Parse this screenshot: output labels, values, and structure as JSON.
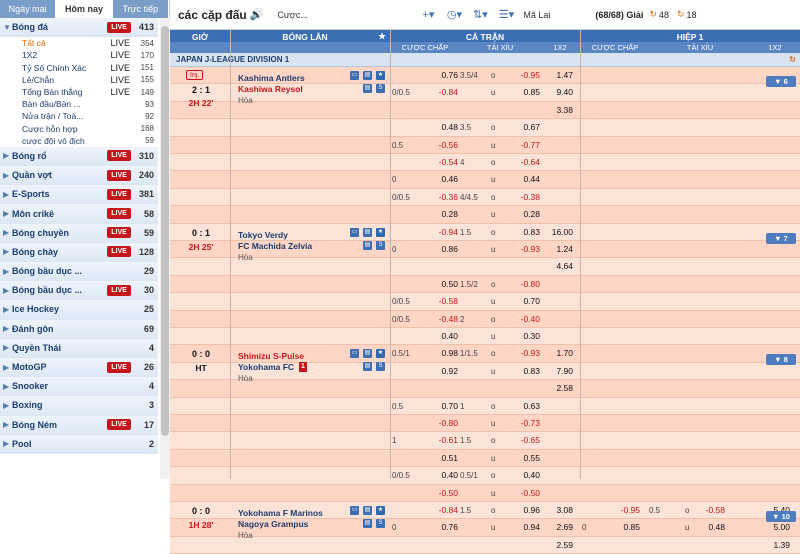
{
  "left_tabs": [
    "Ngày mai",
    "Hôm nay",
    "Trực tiếp"
  ],
  "active_tab": 1,
  "sports": [
    {
      "name": "Bóng đá",
      "live": true,
      "count": "413",
      "expanded": true,
      "subs": [
        {
          "name": "Tất cả",
          "live": true,
          "count": "354",
          "active": true
        },
        {
          "name": "1X2",
          "live": true,
          "count": "170"
        },
        {
          "name": "Tỷ Số Chính Xác",
          "live": true,
          "count": "151"
        },
        {
          "name": "Lẻ/Chẵn",
          "live": true,
          "count": "155"
        },
        {
          "name": "Tổng Bàn thắng",
          "live": true,
          "count": "149"
        },
        {
          "name": "Bàn đầu/Bàn ...",
          "live": false,
          "count": "93"
        },
        {
          "name": "Nửa trận / Toà...",
          "live": false,
          "count": "92"
        },
        {
          "name": "Cược hỗn hợp",
          "live": false,
          "count": "168"
        },
        {
          "name": "cược đội vô địch",
          "live": false,
          "count": "59"
        }
      ]
    },
    {
      "name": "Bóng rổ",
      "live": true,
      "count": "310"
    },
    {
      "name": "Quần vợt",
      "live": true,
      "count": "240"
    },
    {
      "name": "E-Sports",
      "live": true,
      "count": "381"
    },
    {
      "name": "Môn crikê",
      "live": true,
      "count": "58"
    },
    {
      "name": "Bóng chuyền",
      "live": true,
      "count": "59"
    },
    {
      "name": "Bóng chày",
      "live": true,
      "count": "128"
    },
    {
      "name": "Bóng bầu dục ...",
      "live": false,
      "count": "29"
    },
    {
      "name": "Bóng bầu dục ...",
      "live": true,
      "count": "30"
    },
    {
      "name": "Ice Hockey",
      "live": false,
      "count": "25"
    },
    {
      "name": "Đánh gôn",
      "live": false,
      "count": "69"
    },
    {
      "name": "Quyền Thái",
      "live": false,
      "count": "4"
    },
    {
      "name": "MotoGP",
      "live": true,
      "count": "26"
    },
    {
      "name": "Snooker",
      "live": false,
      "count": "4"
    },
    {
      "name": "Boxing",
      "live": false,
      "count": "3"
    },
    {
      "name": "Bóng Ném",
      "live": true,
      "count": "17"
    },
    {
      "name": "Pool",
      "live": false,
      "count": "2"
    }
  ],
  "live_label": "LIVE",
  "topbar": {
    "title": "các cặp đấu",
    "search": "Cược...",
    "odds_type": "Mã Lai",
    "count": "(68/68) Giải",
    "refresh1": "48",
    "refresh2": "18"
  },
  "header": {
    "time": "GIỜ",
    "match": "BÓNG LĂN",
    "ft": "CẢ TRẬN",
    "h1": "HIỆP 1",
    "hdp": "CƯỢC CHẤP",
    "ou": "TÀI XỈU",
    "x12": "1X2"
  },
  "league": "JAPAN J-LEAGUE DIVISION 1",
  "matches": [
    {
      "inj": "Inj.",
      "score": "2 : 1",
      "time": "2H 22'",
      "home": "Kashima Antlers",
      "away": "Kashiwa Reysol",
      "draw": "Hòa",
      "more": "▼ 6",
      "home_red": false,
      "away_red": true,
      "home_card": false
    },
    {
      "score": "0 : 1",
      "time": "2H 25'",
      "home": "Tokyo Verdy",
      "away": "FC Machida Zelvia",
      "draw": "Hòa",
      "more": "▼ 7",
      "home_red": false,
      "away_red": false
    },
    {
      "score": "0 : 0",
      "time": "HT",
      "home": "Shimizu S-Pulse",
      "away": "Yokohama FC",
      "draw": "Hòa",
      "more": "▼ 8",
      "home_red": true,
      "away_red": false,
      "away_card": "1"
    },
    {
      "score": "0 : 0",
      "time": "1H 28'",
      "home": "Yokohama F Marinos",
      "away": "Nagoya Grampus",
      "draw": "Hòa",
      "more": "▼ 10",
      "home_red": false,
      "away_red": false
    }
  ],
  "odds_rows": [
    [
      "",
      "0.76",
      "3.5/4",
      "o",
      "-0.95",
      "1.47"
    ],
    [
      "0/0.5",
      "-0.84",
      "",
      "u",
      "0.85",
      "9.40"
    ],
    [
      "",
      "",
      "",
      "",
      "",
      "3.38"
    ],
    [
      "",
      "0.48",
      "3.5",
      "o",
      "0.67",
      ""
    ],
    [
      "0.5",
      "-0.56",
      "",
      "u",
      "-0.77",
      ""
    ],
    [
      "",
      "-0.54",
      "4",
      "o",
      "-0.64",
      ""
    ],
    [
      "0",
      "0.46",
      "",
      "u",
      "0.44",
      ""
    ],
    [
      "0/0.5",
      "-0.36",
      "4/4.5",
      "o",
      "-0.38",
      ""
    ],
    [
      "",
      "0.28",
      "",
      "u",
      "0.28",
      ""
    ],
    [
      "",
      "-0.94",
      "1.5",
      "o",
      "0.83",
      "16.00"
    ],
    [
      "0",
      "0.86",
      "",
      "u",
      "-0.93",
      "1.24"
    ],
    [
      "",
      "",
      "",
      "",
      "",
      "4.64"
    ],
    [
      "",
      "0.50",
      "1.5/2",
      "o",
      "-0.80",
      ""
    ],
    [
      "0/0.5",
      "-0.58",
      "",
      "u",
      "0.70",
      ""
    ],
    [
      "0/0.5",
      "-0.48",
      "2",
      "o",
      "-0.40",
      ""
    ],
    [
      "",
      "0.40",
      "",
      "u",
      "0.30",
      ""
    ],
    [
      "0.5/1",
      "0.98",
      "1/1.5",
      "o",
      "-0.93",
      "1.70"
    ],
    [
      "",
      "0.92",
      "",
      "u",
      "0.83",
      "7.90"
    ],
    [
      "",
      "",
      "",
      "",
      "",
      "2.58"
    ],
    [
      "0.5",
      "0.70",
      "1",
      "o",
      "0.63",
      ""
    ],
    [
      "",
      "-0.80",
      "",
      "u",
      "-0.73",
      ""
    ],
    [
      "1",
      "-0.61",
      "1.5",
      "o",
      "-0.65",
      ""
    ],
    [
      "",
      "0.51",
      "",
      "u",
      "0.55",
      ""
    ],
    [
      "0/0.5",
      "0.40",
      "0.5/1",
      "o",
      "0.40",
      ""
    ],
    [
      "",
      "-0.50",
      "",
      "u",
      "-0.50",
      ""
    ],
    [
      "",
      "-0.84",
      "1.5",
      "o",
      "0.96",
      "3.08"
    ],
    [
      "0",
      "0.76",
      "",
      "u",
      "0.94",
      "2.69"
    ],
    [
      "",
      "",
      "",
      "",
      "",
      "2.59"
    ]
  ],
  "h1_rows": {
    "25": [
      "",
      "-0.95",
      "0.5",
      "o",
      "-0.58",
      "5.40"
    ],
    "26": [
      "0",
      "0.85",
      "",
      "u",
      "0.48",
      "5.00"
    ],
    "27": [
      "",
      "",
      "",
      "",
      "",
      "1.39"
    ]
  },
  "colors": {
    "header": "#3c6eb4",
    "row": "#ffd6c6",
    "live": "#c4161c",
    "accent": "#e46a00"
  }
}
